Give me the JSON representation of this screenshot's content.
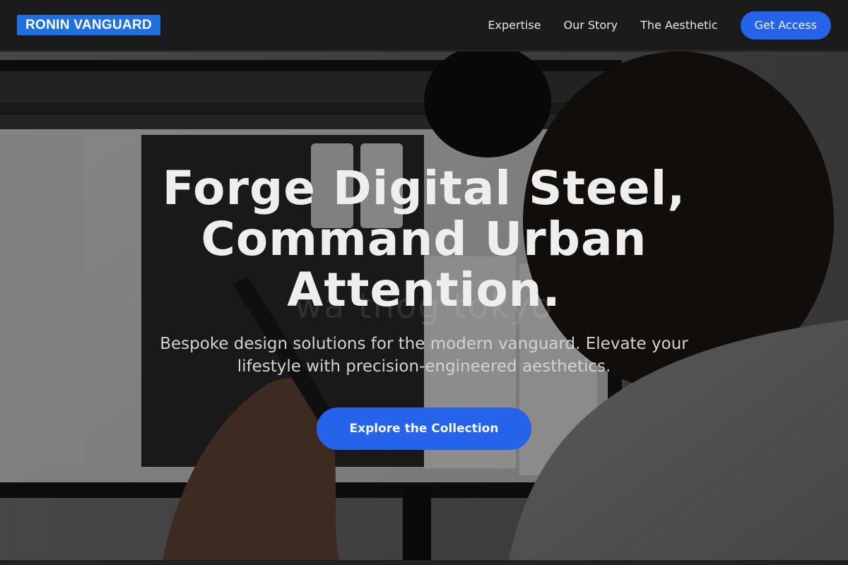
{
  "header": {
    "logo": "RONIN VANGUARD",
    "nav": [
      {
        "label": "Expertise"
      },
      {
        "label": "Our Story"
      },
      {
        "label": "The Aesthetic"
      }
    ],
    "cta_label": "Get Access"
  },
  "hero": {
    "headline": "Forge Digital Steel, Command Urban Attention.",
    "watermark": "wa thog tokyo",
    "subheadline": "Bespoke design solutions for the modern vanguard. Elevate your lifestyle with precision-engineered aesthetics.",
    "cta_label": "Explore the Collection",
    "background_image": "person-at-monitor-photo"
  },
  "colors": {
    "accent": "#2563eb",
    "logo_bg": "#1f6fe0",
    "topbar_bg": "#1b1b1b"
  }
}
